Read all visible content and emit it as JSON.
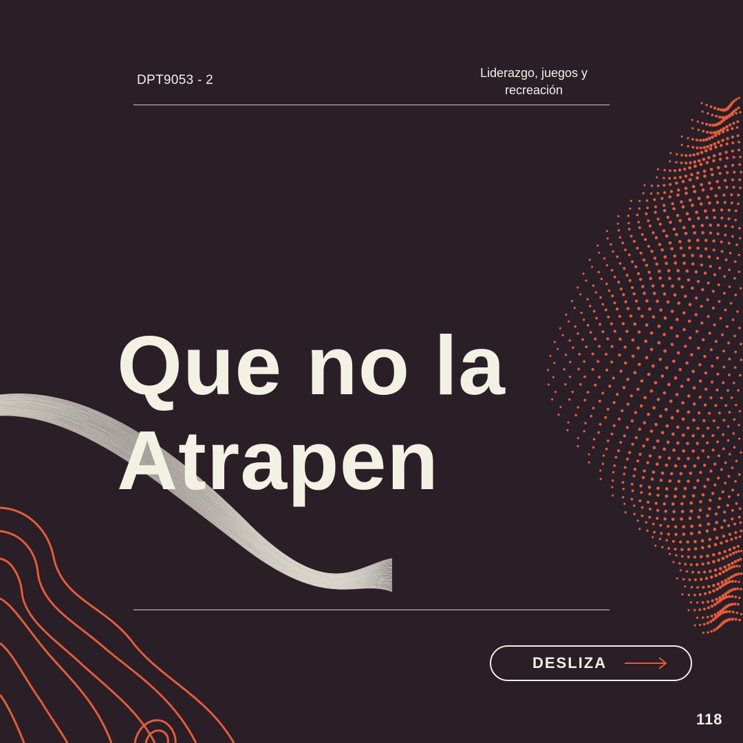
{
  "header": {
    "course_code": "DPT9053 - 2",
    "course_name": "Liderazgo, juegos y recreación"
  },
  "title": {
    "line1": "Que no la",
    "line2": "Atrapen"
  },
  "cta": {
    "label": "DESLIZA",
    "icon": "arrow-right-icon"
  },
  "page_number": "118",
  "colors": {
    "background": "#2a1e27",
    "text": "#f3f1e4",
    "accent": "#e35d3a"
  }
}
